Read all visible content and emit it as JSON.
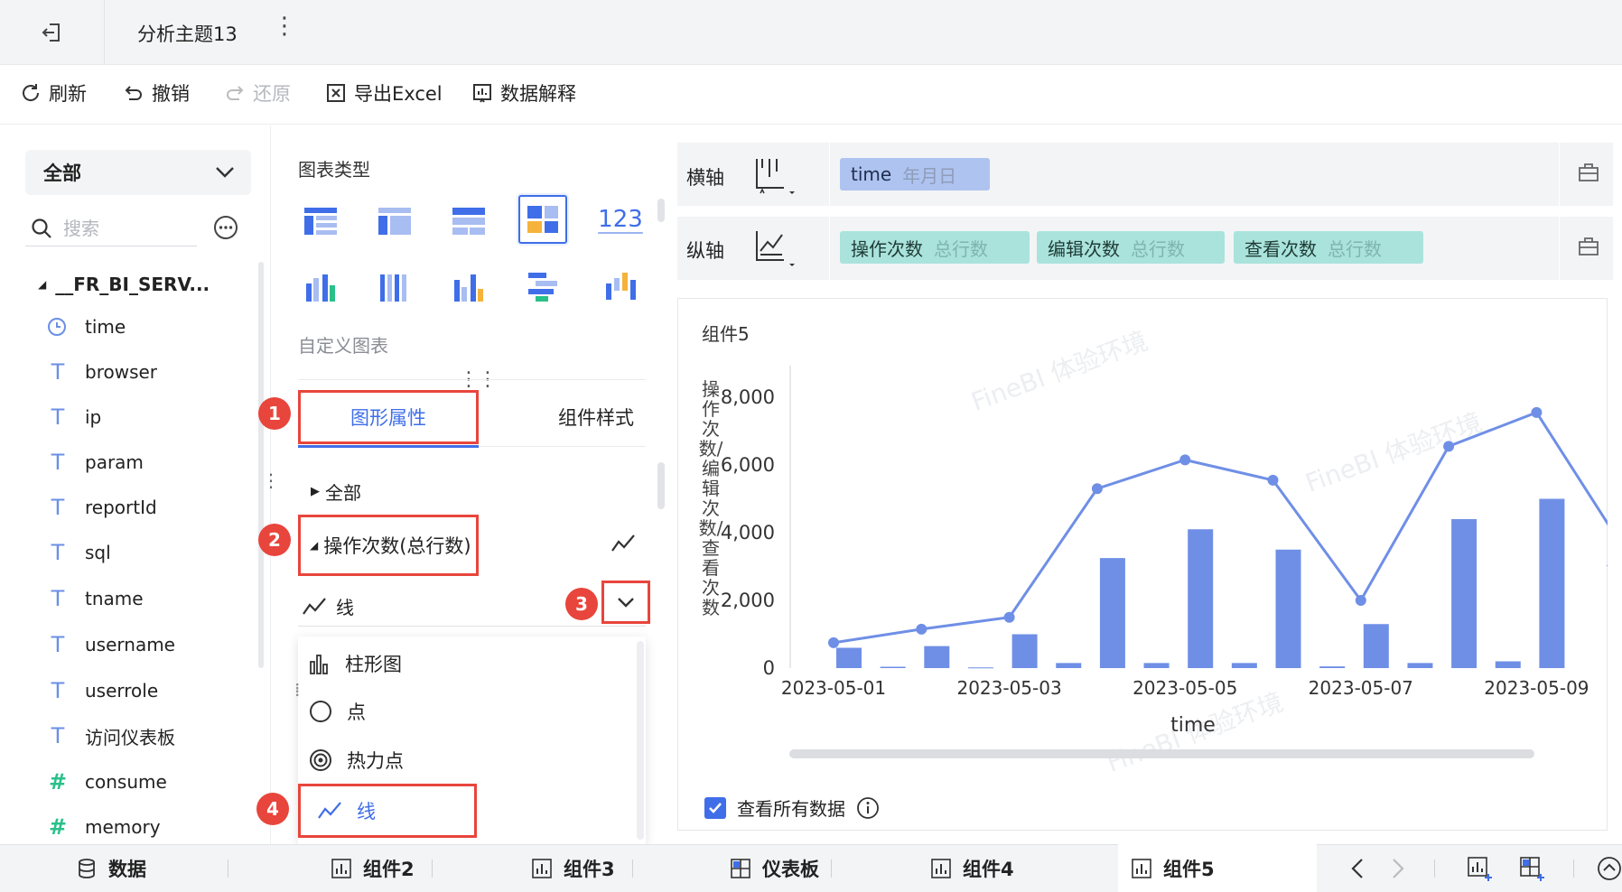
{
  "window": {
    "title": "分析主题13"
  },
  "toolbar": {
    "refresh": "刷新",
    "undo": "撤销",
    "redo": "还原",
    "export": "导出Excel",
    "explain": "数据解释"
  },
  "left": {
    "scope": "全部",
    "search_placeholder": "搜索",
    "dataset": "__FR_BI_SERV...",
    "fields": [
      {
        "name": "time",
        "type": "date"
      },
      {
        "name": "browser",
        "type": "text"
      },
      {
        "name": "ip",
        "type": "text"
      },
      {
        "name": "param",
        "type": "text"
      },
      {
        "name": "reportId",
        "type": "text"
      },
      {
        "name": "sql",
        "type": "text"
      },
      {
        "name": "tname",
        "type": "text"
      },
      {
        "name": "username",
        "type": "text"
      },
      {
        "name": "userrole",
        "type": "text"
      },
      {
        "name": "访问仪表板",
        "type": "text"
      },
      {
        "name": "consume",
        "type": "number"
      },
      {
        "name": "memory",
        "type": "number"
      }
    ]
  },
  "middle": {
    "chart_type_label": "图表类型",
    "chart_123": "123",
    "custom_chart": "自定义图表",
    "tabs": {
      "graph": "图形属性",
      "style": "组件样式"
    },
    "group_all": "全部",
    "group_ops": "操作次数(总行数)",
    "shape_current": "线",
    "menu_items": [
      "柱形图",
      "点",
      "热力点",
      "线"
    ],
    "badges": [
      "1",
      "2",
      "3",
      "4"
    ]
  },
  "axes": {
    "x_label": "横轴",
    "y_label": "纵轴",
    "x_pill": {
      "field": "time",
      "sub": "年月日"
    },
    "y_pills": [
      {
        "field": "操作次数",
        "sub": "总行数"
      },
      {
        "field": "编辑次数",
        "sub": "总行数"
      },
      {
        "field": "查看次数",
        "sub": "总行数"
      }
    ]
  },
  "chart": {
    "component_title": "组件5",
    "ylabel": "操作次数/编辑次数/查看次数",
    "xlabel": "time",
    "watermark": "FineBI 体验环境",
    "view_all": "查看所有数据"
  },
  "chart_data": {
    "type": "bar",
    "title": "组件5",
    "xlabel": "time",
    "ylabel": "操作次数/编辑次数/查看次数",
    "ylim": [
      0,
      8000
    ],
    "yticks": [
      "0",
      "2,000",
      "4,000",
      "6,000",
      "8,000"
    ],
    "x_tick_labels": [
      "2023-05-01",
      "2023-05-03",
      "2023-05-05",
      "2023-05-07",
      "2023-05-09"
    ],
    "bars": [
      600,
      40,
      650,
      20,
      1000,
      150,
      3250,
      150,
      4100,
      150,
      3500,
      50,
      1300,
      150,
      4400,
      200,
      5000
    ],
    "line": [
      750,
      1150,
      1500,
      5300,
      6150,
      5550,
      2000,
      6550,
      7550,
      3500
    ],
    "grid": false,
    "legend": "none"
  },
  "bottom_tabs": {
    "data": "数据",
    "c2": "组件2",
    "c3": "组件3",
    "dashboard": "仪表板",
    "c4": "组件4",
    "c5": "组件5"
  },
  "colors": {
    "accent": "#3f6ee8",
    "bar": "#6f8fe6",
    "highlight": "#e8453c",
    "y_pill": "#a9e3dc",
    "x_pill": "#aec3ef"
  }
}
